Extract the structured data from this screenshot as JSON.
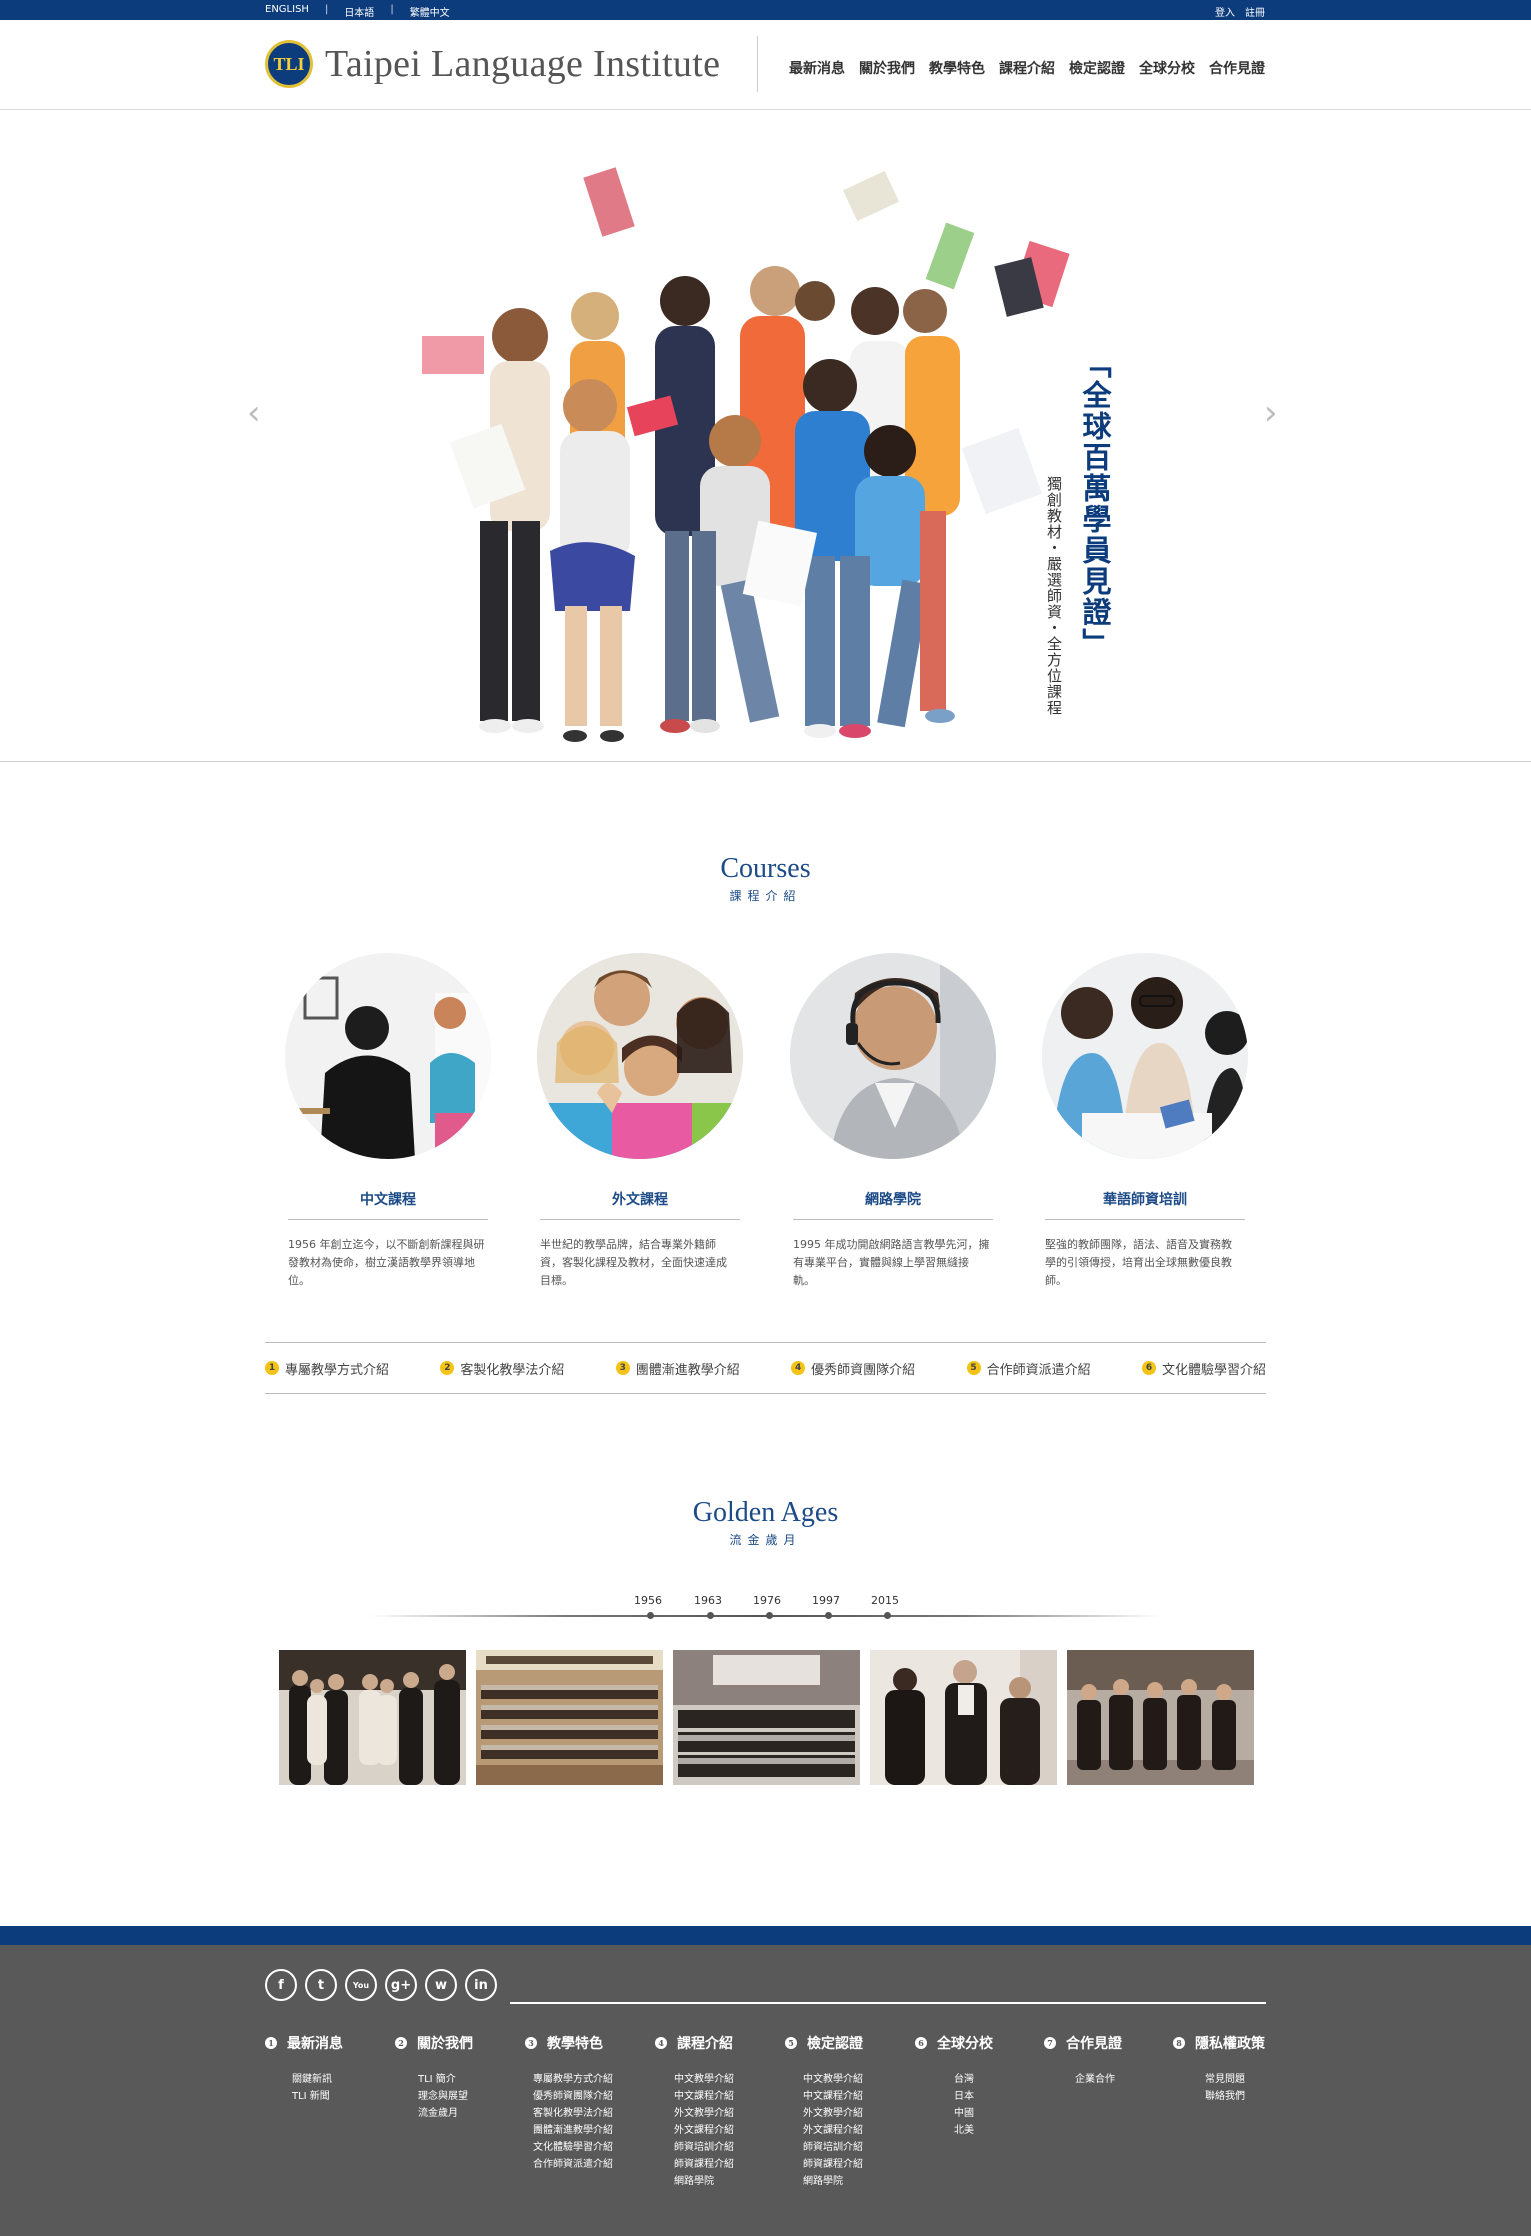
{
  "topbar": {
    "languages": [
      "ENGLISH",
      "日本語",
      "繁體中文"
    ],
    "separator": "|",
    "login": "登入",
    "register": "註冊"
  },
  "header": {
    "logo_badge": "TLI",
    "logo_text": "Taipei Language Institute",
    "nav": [
      "最新消息",
      "關於我們",
      "教學特色",
      "課程介紹",
      "檢定認證",
      "全球分校",
      "合作見證"
    ]
  },
  "hero": {
    "prev": "‹",
    "next": "›",
    "headline": "「全球百萬學員見證」",
    "subline": "獨創教材・嚴選師資・全方位課程"
  },
  "courses": {
    "title_en": "Courses",
    "title_zh": "課程介紹",
    "items": [
      {
        "title": "中文課程",
        "desc": "1956 年創立迄今，以不斷創新課程與研發教材為使命，樹立漢語教學界領導地位。"
      },
      {
        "title": "外文課程",
        "desc": "半世紀的教學品牌，結合專業外籍師資，客製化課程及教材，全面快速達成目標。"
      },
      {
        "title": "網路學院",
        "desc": "1995 年成功開啟網路語言教學先河，擁有專業平台，實體與線上學習無縫接軌。"
      },
      {
        "title": "華語師資培訓",
        "desc": "堅強的教師團隊，語法、語音及實務教學的引領傳授，培育出全球無數優良教師。"
      }
    ],
    "features": [
      {
        "num": "1",
        "label": "專屬教學方式介紹"
      },
      {
        "num": "2",
        "label": "客製化教學法介紹"
      },
      {
        "num": "3",
        "label": "團體漸進教學介紹"
      },
      {
        "num": "4",
        "label": "優秀師資團隊介紹"
      },
      {
        "num": "5",
        "label": "合作師資派遣介紹"
      },
      {
        "num": "6",
        "label": "文化體驗學習介紹"
      }
    ]
  },
  "golden": {
    "title_en": "Golden Ages",
    "title_zh": "流金歲月",
    "years": [
      "1956",
      "1963",
      "1976",
      "1997",
      "2015"
    ]
  },
  "footer": {
    "social_icons": [
      "facebook-icon",
      "twitter-icon",
      "youtube-icon",
      "google-plus-icon",
      "weibo-icon",
      "linkedin-icon"
    ],
    "social_glyphs": [
      "f",
      "t",
      "You",
      "g+",
      "w",
      "in"
    ],
    "columns": [
      {
        "num": "1",
        "title": "最新消息",
        "links": [
          "關鍵新訊",
          "TLI 新聞"
        ]
      },
      {
        "num": "2",
        "title": "關於我們",
        "links": [
          "TLI 簡介",
          "理念與展望",
          "流金歲月"
        ]
      },
      {
        "num": "3",
        "title": "教學特色",
        "links": [
          "專屬教學方式介紹",
          "優秀師資團隊介紹",
          "客製化教學法介紹",
          "團體漸進教學介紹",
          "文化體驗學習介紹",
          "合作師資派遣介紹"
        ]
      },
      {
        "num": "4",
        "title": "課程介紹",
        "links": [
          "中文教學介紹",
          "中文課程介紹",
          "外文教學介紹",
          "外文課程介紹",
          "師資培訓介紹",
          "師資課程介紹",
          "網路學院"
        ]
      },
      {
        "num": "5",
        "title": "檢定認證",
        "links": [
          "中文教學介紹",
          "中文課程介紹",
          "外文教學介紹",
          "外文課程介紹",
          "師資培訓介紹",
          "師資課程介紹",
          "網路學院"
        ]
      },
      {
        "num": "6",
        "title": "全球分校",
        "links": [
          "台灣",
          "日本",
          "中國",
          "北美"
        ]
      },
      {
        "num": "7",
        "title": "合作見證",
        "links": [
          "企業合作"
        ]
      },
      {
        "num": "8",
        "title": "隱私權政策",
        "links": [
          "常見問題",
          "聯絡我們"
        ]
      }
    ]
  },
  "colors": {
    "brand_blue": "#0d3c7c",
    "accent_yellow": "#f3c316",
    "footer_gray": "#595959"
  }
}
